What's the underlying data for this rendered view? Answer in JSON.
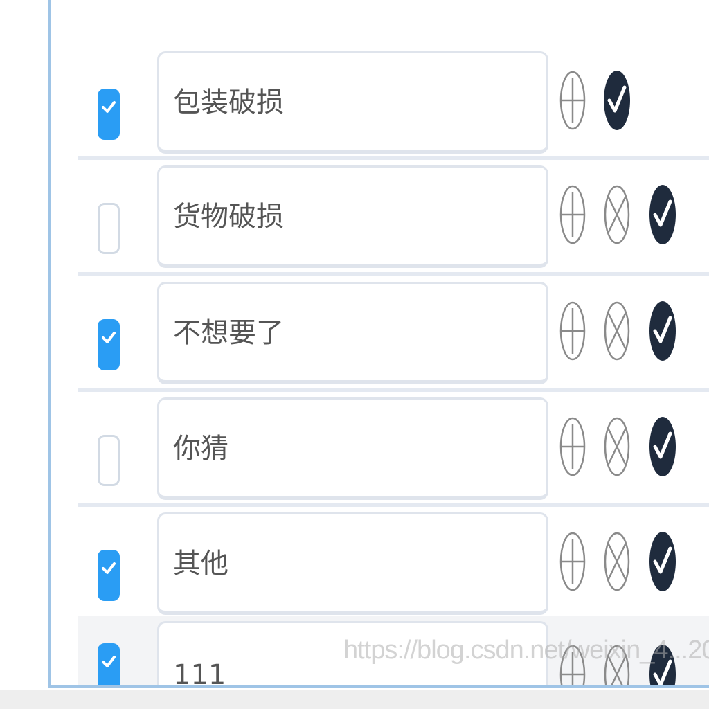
{
  "rows": [
    {
      "text": "包装破损",
      "checked": true,
      "show_remove": false
    },
    {
      "text": "货物破损",
      "checked": false,
      "show_remove": true
    },
    {
      "text": "不想要了",
      "checked": true,
      "show_remove": true
    },
    {
      "text": "你猜",
      "checked": false,
      "show_remove": true
    },
    {
      "text": "其他",
      "checked": true,
      "show_remove": true
    },
    {
      "text": "111",
      "checked": true,
      "show_remove": true
    }
  ],
  "icons": {
    "add": "plus-circle-icon",
    "remove": "x-circle-icon",
    "confirm": "check-circle-icon"
  },
  "colors": {
    "accent": "#2a9df4",
    "panel_border": "#9fc4e6",
    "confirm_icon": "#1f2b3d"
  },
  "watermark": "https://blog.csdn.net/weixin_4...20"
}
